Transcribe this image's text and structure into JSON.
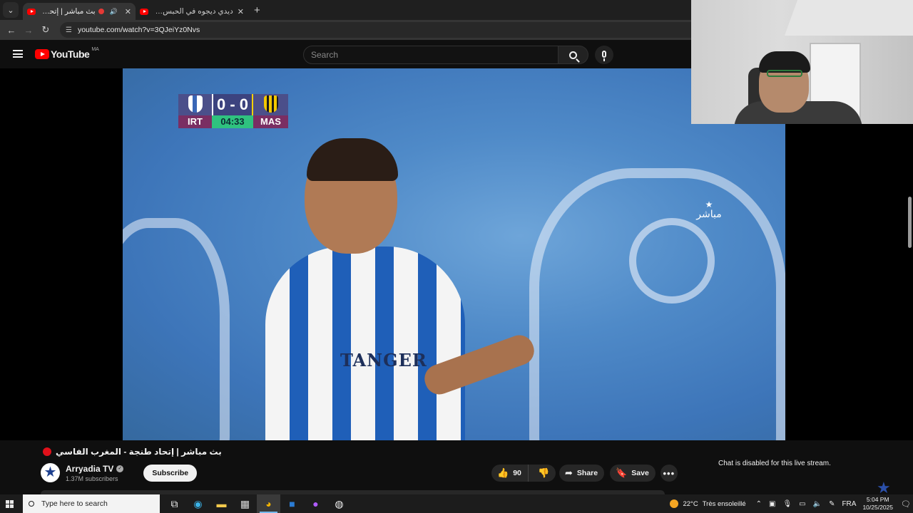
{
  "browser": {
    "tabs": [
      {
        "title": "بث مباشر | إتحاد طنجة",
        "active": true,
        "recording": true,
        "audio": true
      },
      {
        "title": "ديدي ديجوه في الحبس | بنت كانا",
        "active": false
      }
    ],
    "new_tab": "+",
    "url": "youtube.com/watch?v=3QJeiYz0Nvs"
  },
  "youtube": {
    "logo_text": "YouTube",
    "country_code": "MA",
    "search_placeholder": "Search"
  },
  "scoreboard": {
    "home_abbr": "IRT",
    "away_abbr": "MAS",
    "score": "0 - 0",
    "clock": "04:33"
  },
  "video_overlay": {
    "live_label": "مباشر",
    "shirt_text": "TANGER"
  },
  "video": {
    "title": "بث مباشر | إتحاد طنجة - المغرب الفاسي",
    "channel_name": "Arryadia TV",
    "subscribers": "1.37M subscribers",
    "subscribe_label": "Subscribe",
    "likes": "90",
    "share_label": "Share",
    "save_label": "Save"
  },
  "chat": {
    "message": "Chat is disabled for this live stream."
  },
  "taskbar": {
    "search_placeholder": "Type here to search",
    "weather_temp": "22°C",
    "weather_desc": "Très ensoleillé",
    "language": "FRA",
    "time": "5:04 PM",
    "date": "10/25/2025"
  },
  "colors": {
    "youtube_red": "#ff0000",
    "live_red": "#e0101a",
    "scoreboard_time": "#2fc27f",
    "scoreboard_abbr": "#7a2e63"
  }
}
